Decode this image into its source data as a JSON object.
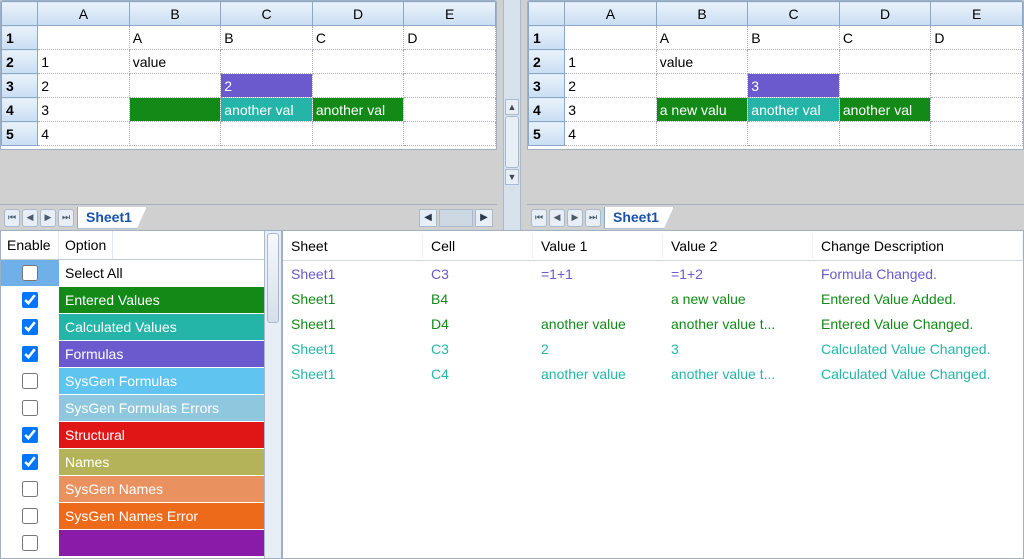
{
  "spreadsheets": {
    "left": {
      "tab": "Sheet1",
      "columns": [
        "A",
        "B",
        "C",
        "D",
        "E"
      ],
      "rows": [
        {
          "hdr": "1",
          "cells": [
            {
              "v": ""
            },
            {
              "v": "A"
            },
            {
              "v": "B"
            },
            {
              "v": "C"
            },
            {
              "v": "D"
            }
          ]
        },
        {
          "hdr": "2",
          "cells": [
            {
              "v": "1"
            },
            {
              "v": "value"
            },
            {
              "v": ""
            },
            {
              "v": ""
            },
            {
              "v": ""
            }
          ]
        },
        {
          "hdr": "3",
          "cells": [
            {
              "v": "2"
            },
            {
              "v": ""
            },
            {
              "v": "2",
              "bg": "bg-indigo"
            },
            {
              "v": ""
            },
            {
              "v": ""
            }
          ]
        },
        {
          "hdr": "4",
          "cells": [
            {
              "v": "3"
            },
            {
              "v": "",
              "bg": "bg-green"
            },
            {
              "v": "another val",
              "bg": "bg-teal"
            },
            {
              "v": "another val",
              "bg": "bg-green"
            },
            {
              "v": ""
            }
          ]
        },
        {
          "hdr": "5",
          "cells": [
            {
              "v": "4"
            },
            {
              "v": ""
            },
            {
              "v": ""
            },
            {
              "v": ""
            },
            {
              "v": ""
            }
          ]
        }
      ]
    },
    "right": {
      "tab": "Sheet1",
      "columns": [
        "A",
        "B",
        "C",
        "D",
        "E"
      ],
      "rows": [
        {
          "hdr": "1",
          "cells": [
            {
              "v": ""
            },
            {
              "v": "A"
            },
            {
              "v": "B"
            },
            {
              "v": "C"
            },
            {
              "v": "D"
            }
          ]
        },
        {
          "hdr": "2",
          "cells": [
            {
              "v": "1"
            },
            {
              "v": "value"
            },
            {
              "v": ""
            },
            {
              "v": ""
            },
            {
              "v": ""
            }
          ]
        },
        {
          "hdr": "3",
          "cells": [
            {
              "v": "2"
            },
            {
              "v": ""
            },
            {
              "v": "3",
              "bg": "bg-indigo"
            },
            {
              "v": ""
            },
            {
              "v": ""
            }
          ]
        },
        {
          "hdr": "4",
          "cells": [
            {
              "v": "3"
            },
            {
              "v": "a new valu",
              "bg": "bg-green"
            },
            {
              "v": "another val",
              "bg": "bg-teal"
            },
            {
              "v": "another val",
              "bg": "bg-green"
            },
            {
              "v": ""
            }
          ]
        },
        {
          "hdr": "5",
          "cells": [
            {
              "v": "4"
            },
            {
              "v": ""
            },
            {
              "v": ""
            },
            {
              "v": ""
            },
            {
              "v": ""
            }
          ]
        }
      ]
    }
  },
  "options": {
    "header_enable": "Enable",
    "header_option": "Option",
    "rows": [
      {
        "checked": false,
        "label": "Select All",
        "cls": "selall"
      },
      {
        "checked": true,
        "label": "Entered Values",
        "cls": "c-green"
      },
      {
        "checked": true,
        "label": "Calculated Values",
        "cls": "c-teal"
      },
      {
        "checked": true,
        "label": "Formulas",
        "cls": "c-indigo"
      },
      {
        "checked": false,
        "label": "SysGen Formulas",
        "cls": "c-sky"
      },
      {
        "checked": false,
        "label": "SysGen Formulas Errors",
        "cls": "c-ltblue"
      },
      {
        "checked": true,
        "label": "Structural",
        "cls": "c-red"
      },
      {
        "checked": true,
        "label": "Names",
        "cls": "c-olive"
      },
      {
        "checked": false,
        "label": "SysGen Names",
        "cls": "c-peach"
      },
      {
        "checked": false,
        "label": "SysGen Names Error",
        "cls": "c-orange"
      },
      {
        "checked": false,
        "label": "",
        "cls": "c-purple"
      }
    ]
  },
  "changes": {
    "header": {
      "sheet": "Sheet",
      "cell": "Cell",
      "v1": "Value 1",
      "v2": "Value 2",
      "desc": "Change Description"
    },
    "rows": [
      {
        "sheet": "Sheet1",
        "cell": "C3",
        "v1": "=1+1",
        "v2": "=1+2",
        "desc": "Formula Changed.",
        "cls": "txt-formula"
      },
      {
        "sheet": "Sheet1",
        "cell": "B4",
        "v1": "",
        "v2": "a new value",
        "desc": "Entered Value Added.",
        "cls": "txt-entered"
      },
      {
        "sheet": "Sheet1",
        "cell": "D4",
        "v1": "another value",
        "v2": "another value t...",
        "desc": "Entered Value Changed.",
        "cls": "txt-entered"
      },
      {
        "sheet": "Sheet1",
        "cell": "C3",
        "v1": "2",
        "v2": "3",
        "desc": "Calculated Value Changed.",
        "cls": "txt-calc"
      },
      {
        "sheet": "Sheet1",
        "cell": "C4",
        "v1": "another value",
        "v2": "another value t...",
        "desc": "Calculated Value Changed.",
        "cls": "txt-calc"
      }
    ]
  }
}
